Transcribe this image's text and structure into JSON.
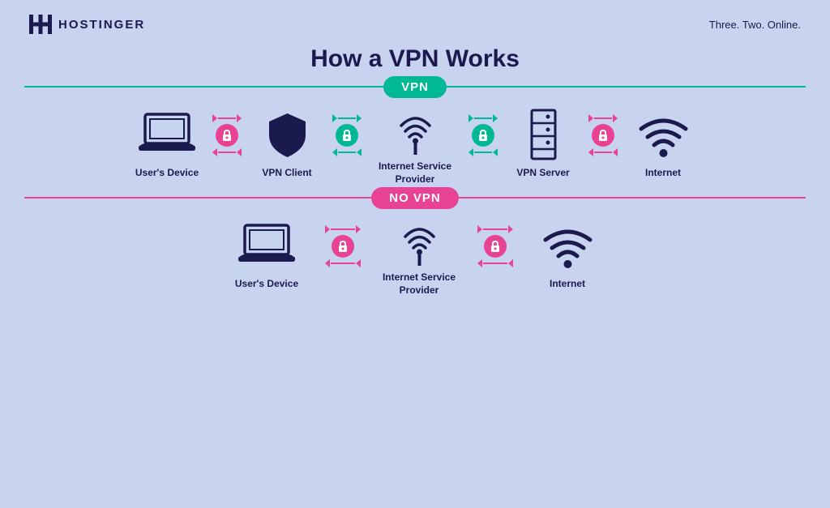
{
  "header": {
    "logo_text": "HOSTINGER",
    "tagline": "Three. Two. Online."
  },
  "main_title": "How a VPN Works",
  "vpn_section": {
    "badge": "VPN",
    "items": [
      {
        "label": "User's Device"
      },
      {
        "label": "VPN Client"
      },
      {
        "label": "Internet Service Provider"
      },
      {
        "label": "VPN Server"
      },
      {
        "label": "Internet"
      }
    ],
    "connectors": [
      {
        "type": "pink"
      },
      {
        "type": "green"
      },
      {
        "type": "green"
      },
      {
        "type": "pink"
      }
    ]
  },
  "novpn_section": {
    "badge": "NO VPN",
    "items": [
      {
        "label": "User's Device"
      },
      {
        "label": "Internet Service Provider"
      },
      {
        "label": "Internet"
      }
    ],
    "connectors": [
      {
        "type": "pink"
      },
      {
        "type": "pink"
      }
    ]
  },
  "colors": {
    "bg": "#c8d3f0",
    "dark_navy": "#1a1a4e",
    "teal": "#00b894",
    "pink": "#e84393"
  }
}
